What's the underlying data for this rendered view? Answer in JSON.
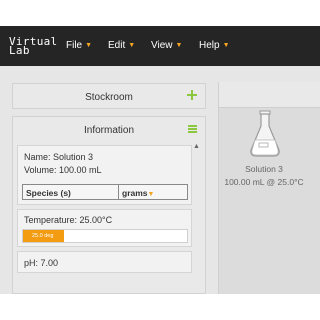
{
  "app": {
    "logo_line1": "Virtual",
    "logo_line2": "Lab"
  },
  "menu": [
    {
      "label": "File"
    },
    {
      "label": "Edit"
    },
    {
      "label": "View"
    },
    {
      "label": "Help"
    }
  ],
  "stockroom": {
    "title": "Stockroom"
  },
  "information": {
    "title": "Information",
    "name_line": "Name: Solution 3",
    "volume_line": "Volume: 100.00 mL",
    "species_header": "Species (s)",
    "units_selected": "grams",
    "temperature_line": "Temperature: 25.00°C",
    "temperature_bar_label": "25.0 deg",
    "temperature_fraction": 0.25,
    "ph_line": "pH: 7.00"
  },
  "bench": {
    "solution_name": "Solution 3",
    "solution_desc": "100.00 mL @ 25.0°C"
  },
  "colors": {
    "topbar": "#252525",
    "accent_orange": "#f39c12",
    "accent_green": "#8dc63f"
  }
}
